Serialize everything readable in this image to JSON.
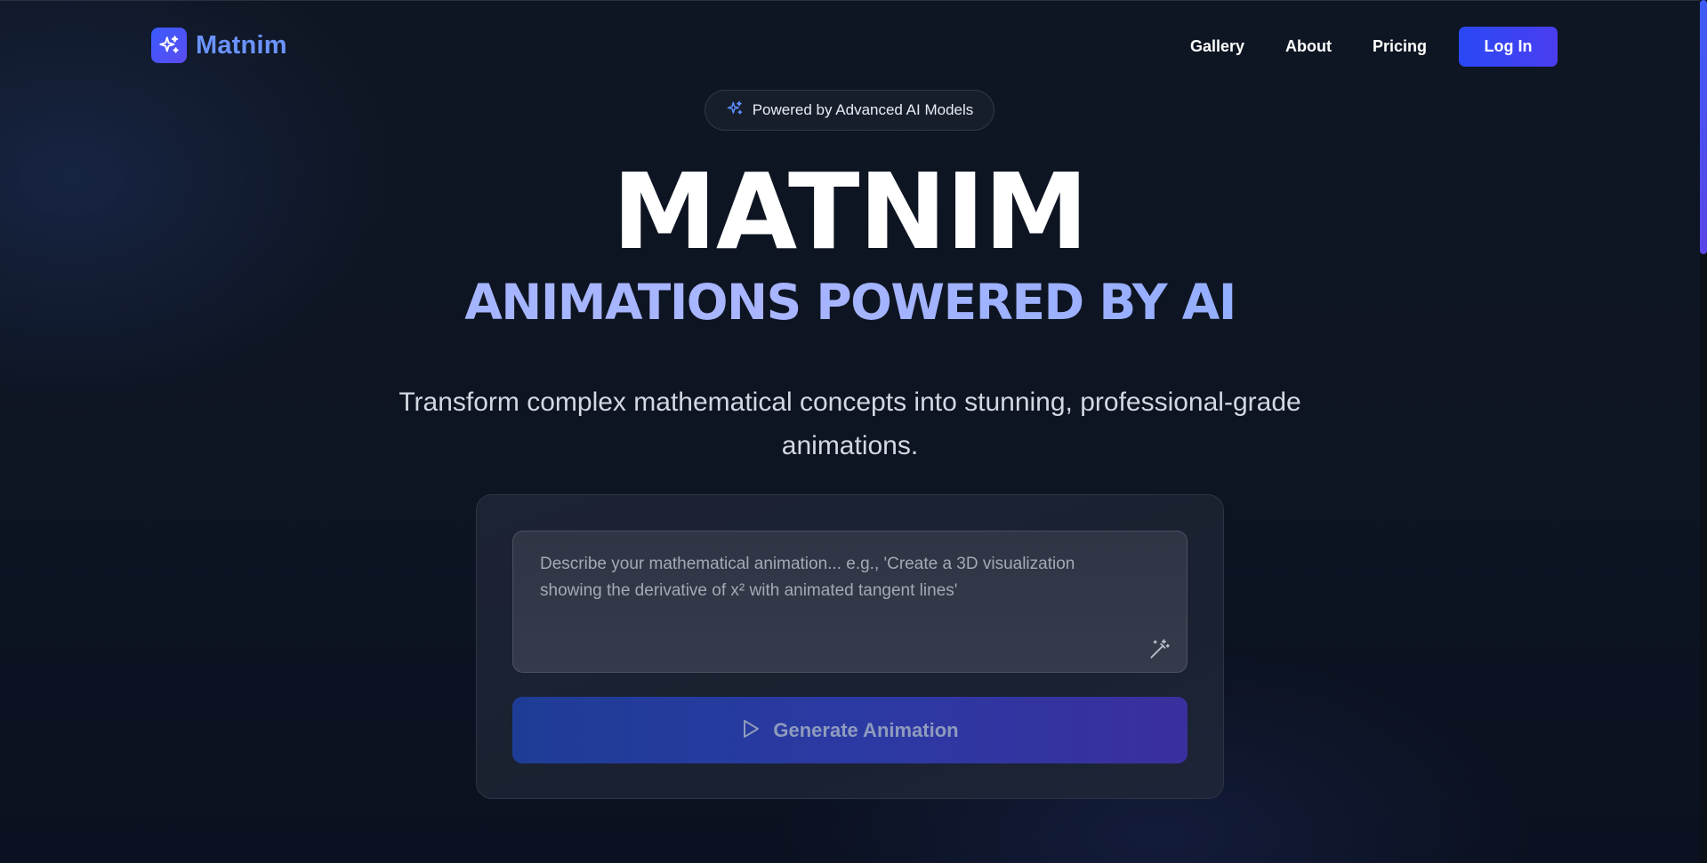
{
  "app": {
    "name": "Matnim",
    "brand_color": "#6b93ff",
    "accent_color": "#3b4ef4"
  },
  "nav": {
    "items": [
      {
        "label": "Gallery"
      },
      {
        "label": "About"
      },
      {
        "label": "Pricing"
      }
    ],
    "login_label": "Log In"
  },
  "hero": {
    "badge_icon": "sparkles-icon",
    "badge_text": "Powered by Advanced AI Models",
    "title": "MATNIM",
    "subtitle": "ANIMATIONS POWERED BY AI",
    "tagline": "Transform complex mathematical concepts into stunning, professional-grade animations."
  },
  "generator": {
    "prompt_placeholder": "Describe your mathematical animation... e.g., 'Create a 3D visualization showing the derivative of x² with animated tangent lines'",
    "prompt_value": "",
    "enhance_icon": "magic-wand-icon",
    "generate_icon": "play-icon",
    "generate_label": "Generate Animation",
    "generate_disabled": true
  }
}
